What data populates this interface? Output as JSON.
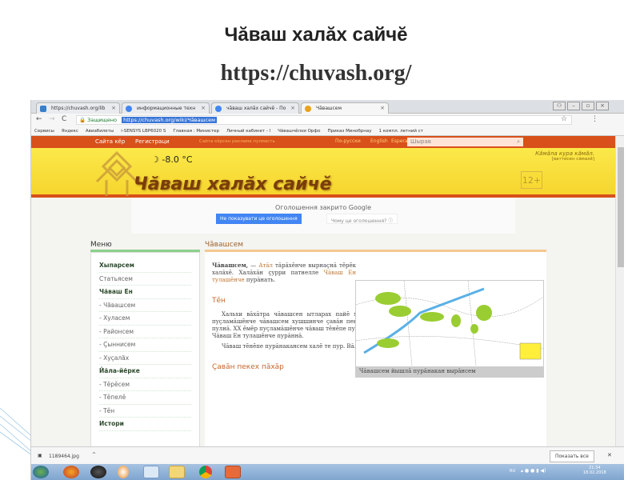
{
  "slide": {
    "title": "Чăваш халăх сайчĕ",
    "url": "https://chuvash.org/"
  },
  "browser": {
    "tabs": [
      "https://chuvash.org/lib",
      "информационные техн",
      "чăваш халăх сайчĕ - По",
      "Чăвашсем"
    ],
    "address_secure": "Защищено",
    "address_url": "https://chuvash.org/wiki/Чăвашсем",
    "bookmarks": [
      "Сервисы",
      "Яндекс",
      "Авиабилеты",
      "i-SENSYS LBP6020 S",
      "Главная : Министер",
      "Личный кабинет - l",
      "Чăвашчĕлхи Орфо",
      "Приказ Минобрнау",
      "1 компл. летний ст"
    ]
  },
  "site": {
    "top_links": [
      "Сайта кĕр",
      "Регистраци"
    ],
    "promo": "Сайта кĕрсен реклама пулмасть",
    "langs": [
      "По-русски",
      "English",
      "Esperanto"
    ],
    "search_placeholder": "Шырав",
    "temperature": "-8.0 °C",
    "logo_text": "Чăваш халăх сайчĕ",
    "motto": "Кăмăла кура кăмăл.",
    "motto_source": "[ваттисен сăмахĕ]",
    "age_rating": "12+"
  },
  "ad": {
    "notice": "Оголошення закрито Google",
    "hide_button": "Не показувати це оголошення",
    "why_button": "Чому це оголошення? ⓘ"
  },
  "menu": {
    "title": "Меню",
    "items": [
      {
        "label": "Хыпарсем",
        "bold": true
      },
      {
        "label": "Статьясем"
      },
      {
        "label": "Чăваш Ен",
        "bold": true
      },
      {
        "label": "- Чăвашсем"
      },
      {
        "label": "- Хуласем"
      },
      {
        "label": "- Районсем"
      },
      {
        "label": "- Çыннисем"
      },
      {
        "label": "- Хуçалăх"
      },
      {
        "label": "Йăла-йĕрке",
        "bold": true
      },
      {
        "label": "- Тĕрĕсем"
      },
      {
        "label": "- Тĕпелĕ"
      },
      {
        "label": "- Тĕн"
      },
      {
        "label": "Истори",
        "bold": true
      }
    ]
  },
  "article": {
    "title": "Чăвашсем",
    "intro_term": "Чăвашсем,",
    "intro_1": " — ",
    "intro_link1": "Атăл",
    "intro_2": " тăрăхĕнче вырнаçнă тĕрĕк халăхĕ. Халăхăн çурри патнелле ",
    "intro_link2": "Чăваш Ен тулашĕнче",
    "intro_3": " пурăнать.",
    "section1": "Тĕн",
    "p1": "Хальхи вăхăтра чăвашсен ытларах пайĕ христиан тĕнĕн йĕркипе пурăнать. XVIII ĕмĕрте–XX ĕмĕр пуçламăшĕнче чăвашсем хушшинче çавăн пекех халăх тĕнĕпе пурăнакансем тата тутарланнă чăвашсем пулнă. XX ĕмĕр пуçламăшĕнче чăваш тĕнĕпе пурăнакансен йышĕ 15 пине яхăн пулнă. Ытларах вĕсем хальхи Чăваш Ен тулашĕнче пурăннă.",
    "p2": "Чăваш тĕнĕпе пурăнакансем халĕ те пур. Вăл ялсем Чăваш Енре, Самар облаçĕнче вырнаçнă.",
    "section2": "Çавăн пекех пăхăр",
    "map_caption": "Чăвашсем йышлă пурăнакан вырăнсем"
  },
  "download": {
    "file": "1189464.jpg",
    "show_all": "Показать все",
    "close": "✕"
  },
  "taskbar": {
    "lang": "RU",
    "time": "21:34",
    "date": "18.02.2018"
  },
  "colors": {
    "orange": "#d8501a",
    "yellow": "#fbe94a",
    "menu_accent": "#8bd18b",
    "content_accent": "#f3c891",
    "link": "#c0762f"
  }
}
